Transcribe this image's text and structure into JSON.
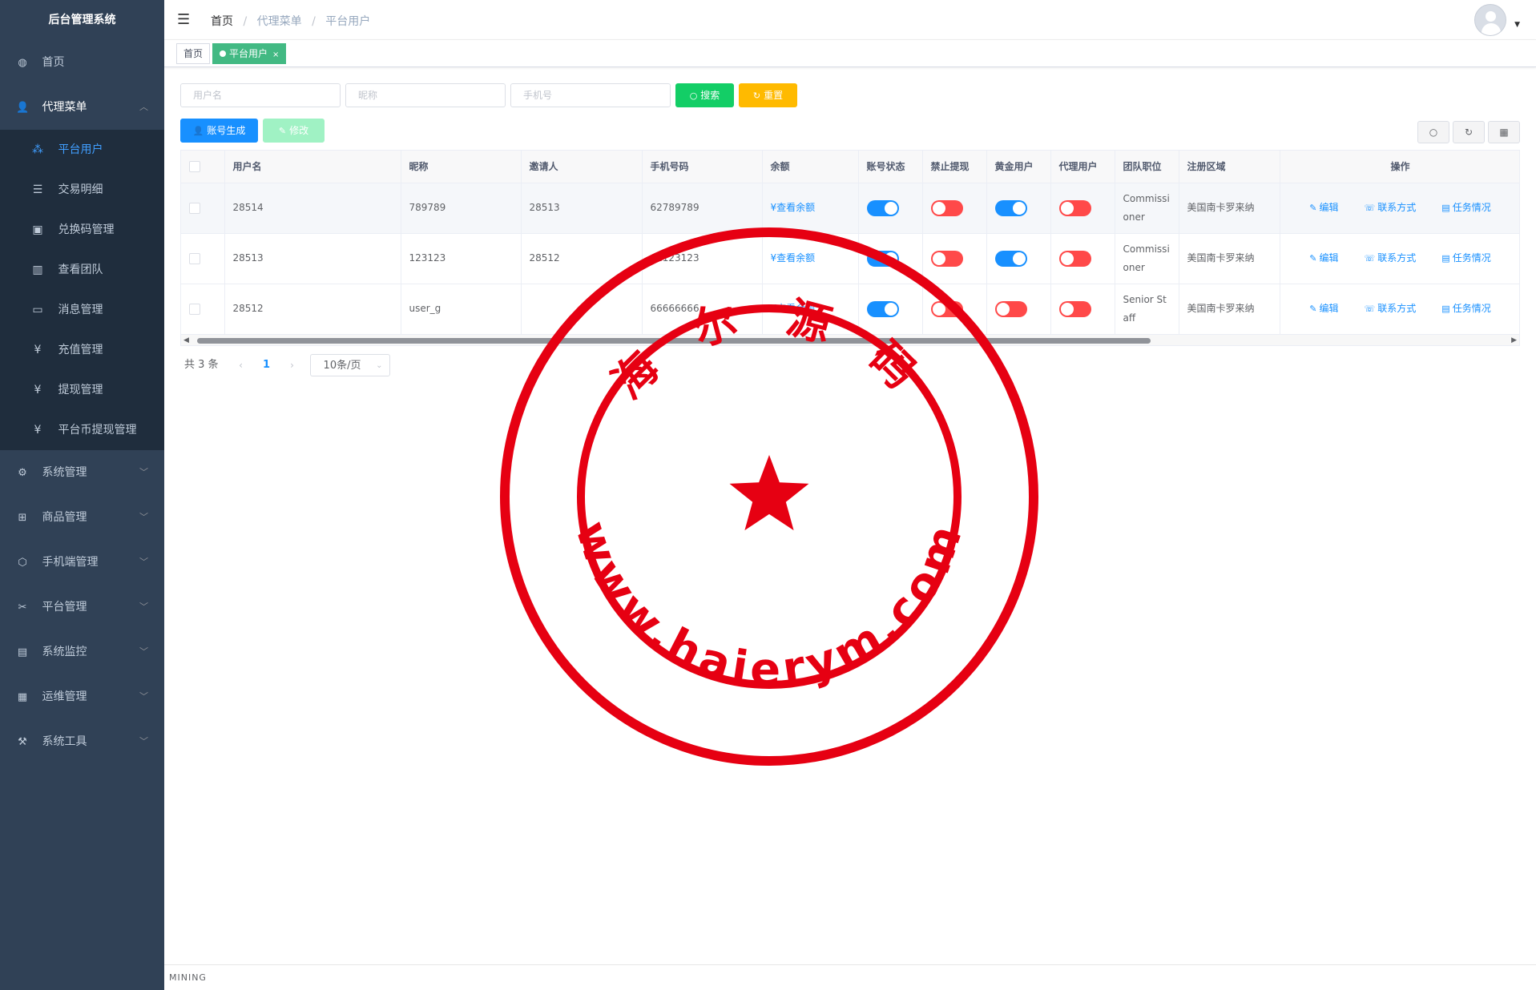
{
  "app": {
    "title": "后台管理系统"
  },
  "sidebar": {
    "items": [
      {
        "label": "首页",
        "icon": "dashboard-icon",
        "glyph": "◍"
      },
      {
        "label": "代理菜单",
        "icon": "user-icon",
        "glyph": "👥",
        "expanded": true,
        "children": [
          {
            "label": "平台用户",
            "icon": "tree-icon",
            "glyph": "⁂",
            "active": true
          },
          {
            "label": "交易明细",
            "icon": "list-icon",
            "glyph": "☰"
          },
          {
            "label": "兑换码管理",
            "icon": "code-icon",
            "glyph": "▣"
          },
          {
            "label": "查看团队",
            "icon": "chart-icon",
            "glyph": "▥"
          },
          {
            "label": "消息管理",
            "icon": "message-icon",
            "glyph": "▭"
          },
          {
            "label": "充值管理",
            "icon": "yen-icon",
            "glyph": "¥"
          },
          {
            "label": "提现管理",
            "icon": "yen-icon",
            "glyph": "¥"
          },
          {
            "label": "平台币提现管理",
            "icon": "yen-icon",
            "glyph": "¥"
          }
        ]
      },
      {
        "label": "系统管理",
        "icon": "gear-icon",
        "glyph": "⚙"
      },
      {
        "label": "商品管理",
        "icon": "cart-icon",
        "glyph": "⊞"
      },
      {
        "label": "手机端管理",
        "icon": "box-icon",
        "glyph": "⬡"
      },
      {
        "label": "平台管理",
        "icon": "tools-icon",
        "glyph": "✂"
      },
      {
        "label": "系统监控",
        "icon": "monitor-icon",
        "glyph": "▤"
      },
      {
        "label": "运维管理",
        "icon": "server-icon",
        "glyph": "▦"
      },
      {
        "label": "系统工具",
        "icon": "wrench-icon",
        "glyph": "⚒"
      }
    ]
  },
  "navbar": {
    "hamburger_glyph": "☰",
    "breadcrumb": [
      "首页",
      "代理菜单",
      "平台用户"
    ]
  },
  "tags": {
    "home": "首页",
    "current": "平台用户",
    "close": "×"
  },
  "search": {
    "username_placeholder": "用户名",
    "nickname_placeholder": "昵称",
    "phone_placeholder": "手机号",
    "search_button": "搜索",
    "reset_button": "重置"
  },
  "toolbar": {
    "generate_button": "账号生成",
    "edit_button": "修改",
    "search_tool_glyph": "○",
    "refresh_tool_glyph": "↻",
    "columns_tool_glyph": "▦"
  },
  "table": {
    "headers": [
      "用户名",
      "昵称",
      "邀请人",
      "手机号码",
      "余额",
      "账号状态",
      "禁止提现",
      "黄金用户",
      "代理用户",
      "团队职位",
      "注册区域",
      "操作"
    ],
    "rows": [
      {
        "username": "28514",
        "nickname": "789789",
        "inviter": "28513",
        "phone": "62789789",
        "balance": "¥查看余额",
        "status": true,
        "withdraw_ban": false,
        "gold": true,
        "agent": false,
        "position": "Commissioner",
        "region": "美国南卡罗来纳"
      },
      {
        "username": "28513",
        "nickname": "123123",
        "inviter": "28512",
        "phone": "62123123",
        "balance": "¥查看余额",
        "status": true,
        "withdraw_ban": false,
        "gold": true,
        "agent": false,
        "position": "Commissioner",
        "region": "美国南卡罗来纳"
      },
      {
        "username": "28512",
        "nickname": "user_g",
        "inviter": "",
        "phone": "66666666",
        "balance": "¥查看余额",
        "status": true,
        "withdraw_ban": false,
        "gold": false,
        "agent": false,
        "position": "Senior Staff",
        "region": "美国南卡罗来纳"
      }
    ],
    "ops": {
      "edit": "编辑",
      "contact": "联系方式",
      "task": "任务情况"
    }
  },
  "pagination": {
    "total": "共 3 条",
    "current_page": "1",
    "page_size": "10条/页",
    "prev": "‹",
    "next": "›"
  },
  "footer": {
    "text": "MINING"
  },
  "watermark": {
    "top_text": "海 尔 源 码",
    "bottom_text": "www.haierym.com",
    "color": "#e60012"
  },
  "colors": {
    "sidebar_bg": "#304156",
    "primary": "#1890ff",
    "success": "#13ce66",
    "warning": "#ffba00",
    "danger": "#ff4949"
  }
}
